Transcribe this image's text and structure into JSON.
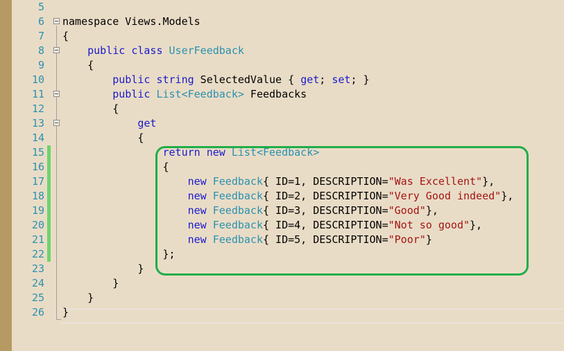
{
  "editor": {
    "lines": [
      {
        "num": "5",
        "tokens": []
      },
      {
        "num": "6",
        "tokens": [
          {
            "t": "namespace Views.Models",
            "c": ""
          }
        ]
      },
      {
        "num": "7",
        "tokens": [
          {
            "t": "{",
            "c": ""
          }
        ]
      },
      {
        "num": "8",
        "tokens": [
          {
            "t": "    ",
            "c": ""
          },
          {
            "t": "public",
            "c": "kw"
          },
          {
            "t": " ",
            "c": ""
          },
          {
            "t": "class",
            "c": "kw"
          },
          {
            "t": " ",
            "c": ""
          },
          {
            "t": "UserFeedback",
            "c": "ty"
          }
        ]
      },
      {
        "num": "9",
        "tokens": [
          {
            "t": "    {",
            "c": ""
          }
        ]
      },
      {
        "num": "10",
        "tokens": [
          {
            "t": "        ",
            "c": ""
          },
          {
            "t": "public",
            "c": "kw"
          },
          {
            "t": " ",
            "c": ""
          },
          {
            "t": "string",
            "c": "kw"
          },
          {
            "t": " SelectedValue { ",
            "c": ""
          },
          {
            "t": "get",
            "c": "kw"
          },
          {
            "t": "; ",
            "c": ""
          },
          {
            "t": "set",
            "c": "kw"
          },
          {
            "t": "; }",
            "c": ""
          }
        ]
      },
      {
        "num": "11",
        "tokens": [
          {
            "t": "        ",
            "c": ""
          },
          {
            "t": "public",
            "c": "kw"
          },
          {
            "t": " ",
            "c": ""
          },
          {
            "t": "List",
            "c": "ty"
          },
          {
            "t": "<",
            "c": "ty"
          },
          {
            "t": "Feedback",
            "c": "ty"
          },
          {
            "t": ">",
            "c": "ty"
          },
          {
            "t": " Feedbacks",
            "c": ""
          }
        ]
      },
      {
        "num": "12",
        "tokens": [
          {
            "t": "        {",
            "c": ""
          }
        ]
      },
      {
        "num": "13",
        "tokens": [
          {
            "t": "            ",
            "c": ""
          },
          {
            "t": "get",
            "c": "kw"
          }
        ]
      },
      {
        "num": "14",
        "tokens": [
          {
            "t": "            {",
            "c": ""
          }
        ]
      },
      {
        "num": "15",
        "tokens": [
          {
            "t": "                ",
            "c": ""
          },
          {
            "t": "return",
            "c": "kw"
          },
          {
            "t": " ",
            "c": ""
          },
          {
            "t": "new",
            "c": "kw"
          },
          {
            "t": " ",
            "c": ""
          },
          {
            "t": "List<Feedback>",
            "c": "ty"
          }
        ]
      },
      {
        "num": "16",
        "tokens": [
          {
            "t": "                {",
            "c": ""
          }
        ]
      },
      {
        "num": "17",
        "tokens": [
          {
            "t": "                    ",
            "c": ""
          },
          {
            "t": "new",
            "c": "kw"
          },
          {
            "t": " ",
            "c": ""
          },
          {
            "t": "Feedback",
            "c": "ty"
          },
          {
            "t": "{ ID=1, DESCRIPTION=",
            "c": ""
          },
          {
            "t": "\"Was Excellent\"",
            "c": "st"
          },
          {
            "t": "},",
            "c": ""
          }
        ]
      },
      {
        "num": "18",
        "tokens": [
          {
            "t": "                    ",
            "c": ""
          },
          {
            "t": "new",
            "c": "kw"
          },
          {
            "t": " ",
            "c": ""
          },
          {
            "t": "Feedback",
            "c": "ty"
          },
          {
            "t": "{ ID=2, DESCRIPTION=",
            "c": ""
          },
          {
            "t": "\"Very Good indeed\"",
            "c": "st"
          },
          {
            "t": "},",
            "c": ""
          }
        ]
      },
      {
        "num": "19",
        "tokens": [
          {
            "t": "                    ",
            "c": ""
          },
          {
            "t": "new",
            "c": "kw"
          },
          {
            "t": " ",
            "c": ""
          },
          {
            "t": "Feedback",
            "c": "ty"
          },
          {
            "t": "{ ID=3, DESCRIPTION=",
            "c": ""
          },
          {
            "t": "\"Good\"",
            "c": "st"
          },
          {
            "t": "},",
            "c": ""
          }
        ]
      },
      {
        "num": "20",
        "tokens": [
          {
            "t": "                    ",
            "c": ""
          },
          {
            "t": "new",
            "c": "kw"
          },
          {
            "t": " ",
            "c": ""
          },
          {
            "t": "Feedback",
            "c": "ty"
          },
          {
            "t": "{ ID=4, DESCRIPTION=",
            "c": ""
          },
          {
            "t": "\"Not so good\"",
            "c": "st"
          },
          {
            "t": "},",
            "c": ""
          }
        ]
      },
      {
        "num": "21",
        "tokens": [
          {
            "t": "                    ",
            "c": ""
          },
          {
            "t": "new",
            "c": "kw"
          },
          {
            "t": " ",
            "c": ""
          },
          {
            "t": "Feedback",
            "c": "ty"
          },
          {
            "t": "{ ID=5, DESCRIPTION=",
            "c": ""
          },
          {
            "t": "\"Poor\"",
            "c": "st"
          },
          {
            "t": "}",
            "c": ""
          }
        ]
      },
      {
        "num": "22",
        "tokens": [
          {
            "t": "                };",
            "c": ""
          }
        ]
      },
      {
        "num": "23",
        "tokens": [
          {
            "t": "            }",
            "c": ""
          }
        ]
      },
      {
        "num": "24",
        "tokens": [
          {
            "t": "        }",
            "c": ""
          }
        ]
      },
      {
        "num": "25",
        "tokens": [
          {
            "t": "    }",
            "c": ""
          }
        ]
      },
      {
        "num": "26",
        "tokens": [
          {
            "t": "}",
            "c": ""
          }
        ]
      }
    ],
    "changed_lines": [
      "15",
      "16",
      "17",
      "18",
      "19",
      "20",
      "21",
      "22"
    ],
    "fold_markers": [
      "6",
      "8",
      "11",
      "13"
    ],
    "colors": {
      "keyword": "#1a1acb",
      "type": "#2b91af",
      "string": "#a31515",
      "line_number": "#2b91af",
      "change_bar": "#6cd46c",
      "highlight_border": "#1fae49",
      "background": "#e9dcc6",
      "left_strip": "#b69a63"
    }
  }
}
